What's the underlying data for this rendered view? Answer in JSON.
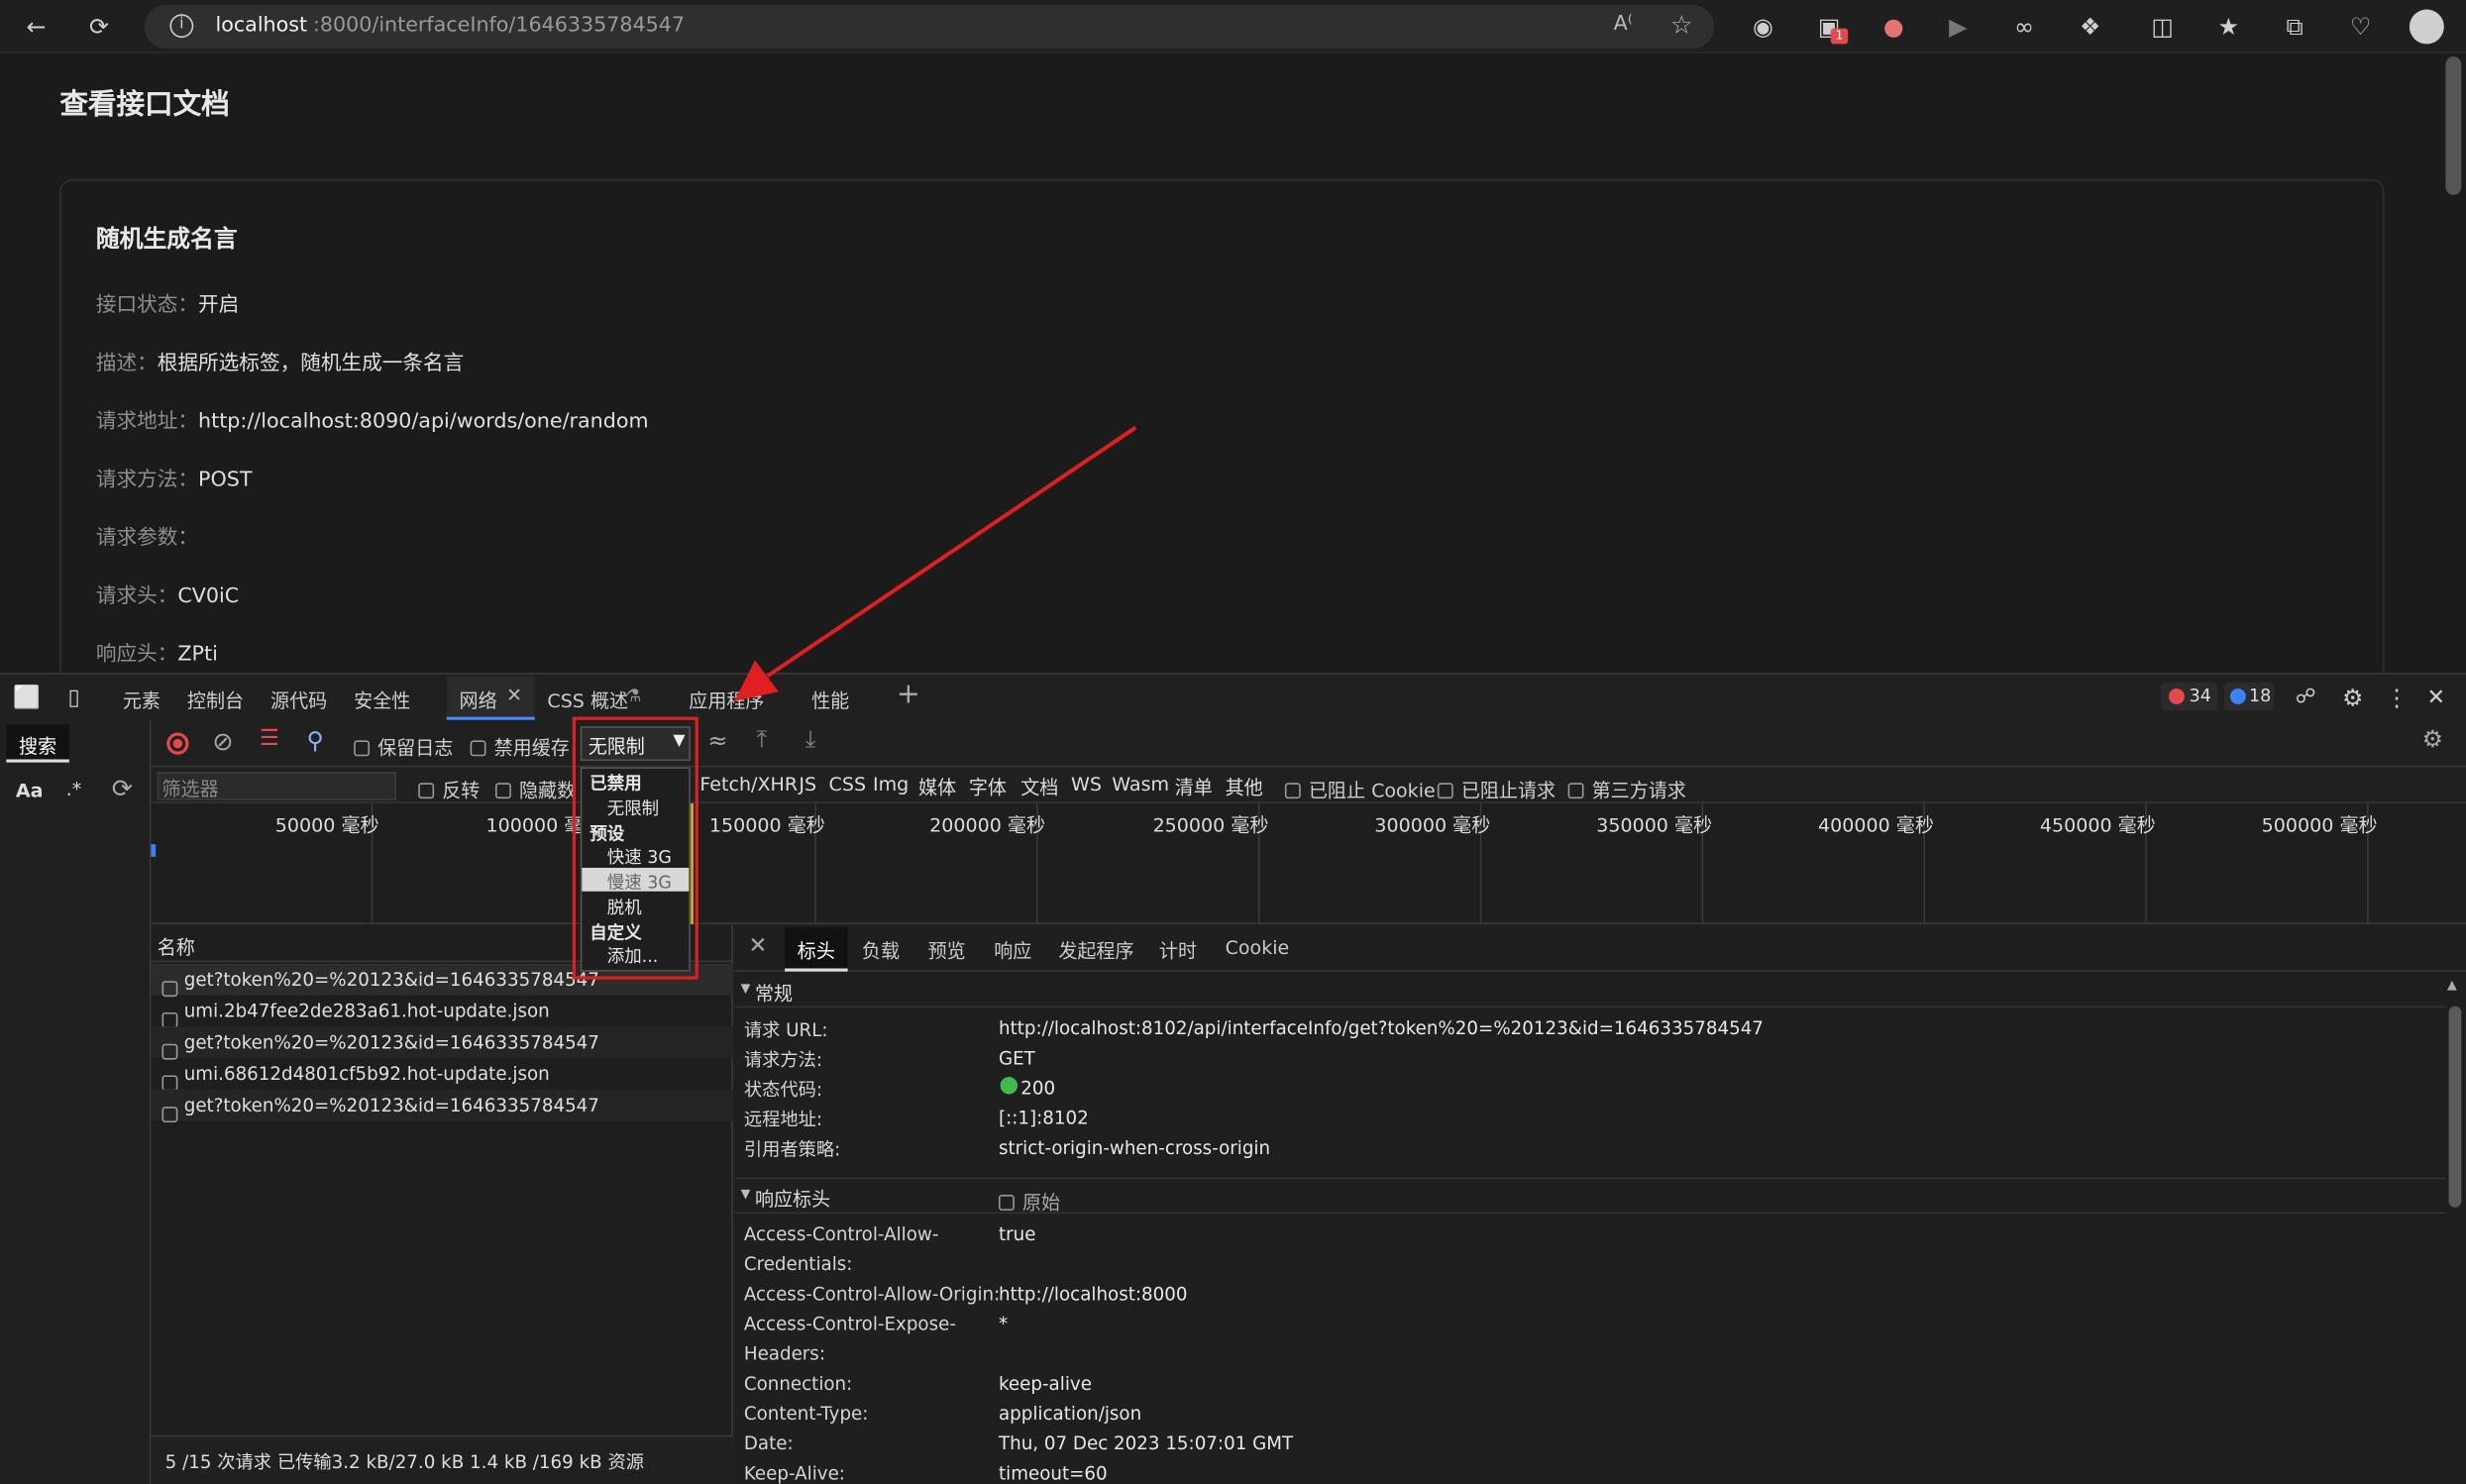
{
  "browser": {
    "url_host": "localhost",
    "url_path": ":8000/interfaceInfo/1646335784547",
    "badge_count": "1"
  },
  "page": {
    "title": "查看接口文档",
    "card_title": "随机生成名言",
    "fields": [
      {
        "label": "接口状态：",
        "value": "开启"
      },
      {
        "label": "描述：",
        "value": "根据所选标签，随机生成一条名言"
      },
      {
        "label": "请求地址：",
        "value": "http://localhost:8090/api/words/one/random"
      },
      {
        "label": "请求方法：",
        "value": "POST"
      },
      {
        "label": "请求参数：",
        "value": ""
      },
      {
        "label": "请求头：",
        "value": "CV0iC"
      },
      {
        "label": "响应头：",
        "value": "ZPti"
      }
    ]
  },
  "devtools": {
    "tabs": [
      "元素",
      "控制台",
      "源代码",
      "安全性",
      "网络",
      "CSS 概述",
      "应用程序",
      "性能"
    ],
    "error_count": "34",
    "message_count": "18",
    "search_tab": "搜索",
    "aa": "Aa",
    "regex": ".*",
    "network": {
      "preserve_log": "保留日志",
      "disable_cache": "禁用缓存",
      "throttle_selected": "无限制",
      "filter_placeholder": "筛选器",
      "invert": "反转",
      "hide_data": "隐藏数",
      "type_filters": [
        "Fetch/XHR",
        "JS",
        "CSS",
        "Img",
        "媒体",
        "字体",
        "文档",
        "WS",
        "Wasm",
        "清单",
        "其他"
      ],
      "blocked_cookies": "已阻止 Cookie",
      "blocked_requests": "已阻止请求",
      "third_party": "第三方请求",
      "timeline_ticks": [
        "50000 毫秒",
        "100000 毫",
        "150000 毫秒",
        "200000 毫秒",
        "250000 毫秒",
        "300000 毫秒",
        "350000 毫秒",
        "400000 毫秒",
        "450000 毫秒",
        "500000 毫秒"
      ],
      "throttle_menu": [
        {
          "text": "已禁用",
          "kind": "header"
        },
        {
          "text": "无限制",
          "kind": "item"
        },
        {
          "text": "预设",
          "kind": "header"
        },
        {
          "text": "快速 3G",
          "kind": "item"
        },
        {
          "text": "慢速 3G",
          "kind": "item-hover"
        },
        {
          "text": "脱机",
          "kind": "item"
        },
        {
          "text": "自定义",
          "kind": "header"
        },
        {
          "text": "添加...",
          "kind": "item"
        }
      ],
      "name_header": "名称",
      "requests": [
        "get?token%20=%20123&id=1646335784547",
        "umi.2b47fee2de283a61.hot-update.json",
        "get?token%20=%20123&id=1646335784547",
        "umi.68612d4801cf5b92.hot-update.json",
        "get?token%20=%20123&id=1646335784547"
      ],
      "status_bar": "5 /15 次请求  已传输3.2 kB/27.0 kB  1.4 kB /169 kB 资源",
      "detail_tabs": [
        "标头",
        "负载",
        "预览",
        "响应",
        "发起程序",
        "计时",
        "Cookie"
      ],
      "general_title": "常规",
      "general": [
        {
          "k": "请求 URL:",
          "v": "http://localhost:8102/api/interfaceInfo/get?token%20=%20123&id=1646335784547"
        },
        {
          "k": "请求方法:",
          "v": "GET"
        },
        {
          "k": "状态代码:",
          "v": "200"
        },
        {
          "k": "远程地址:",
          "v": "[::1]:8102"
        },
        {
          "k": "引用者策略:",
          "v": "strict-origin-when-cross-origin"
        }
      ],
      "response_title": "响应标头",
      "raw_label": "原始",
      "response_headers": [
        {
          "k": "Access-Control-Allow-",
          "v": "true"
        },
        {
          "k": "Credentials:",
          "v": ""
        },
        {
          "k": "Access-Control-Allow-Origin:",
          "v": "http://localhost:8000"
        },
        {
          "k": "Access-Control-Expose-",
          "v": "*"
        },
        {
          "k": "Headers:",
          "v": ""
        },
        {
          "k": "Connection:",
          "v": "keep-alive"
        },
        {
          "k": "Content-Type:",
          "v": "application/json"
        },
        {
          "k": "Date:",
          "v": "Thu, 07 Dec 2023 15:07:01 GMT"
        },
        {
          "k": "Keep-Alive:",
          "v": "timeout=60"
        }
      ]
    }
  },
  "colors": {
    "accent_red": "#e02020",
    "status_green": "#3fb950",
    "error_red": "#e5484d",
    "info_blue": "#3b82f6"
  }
}
